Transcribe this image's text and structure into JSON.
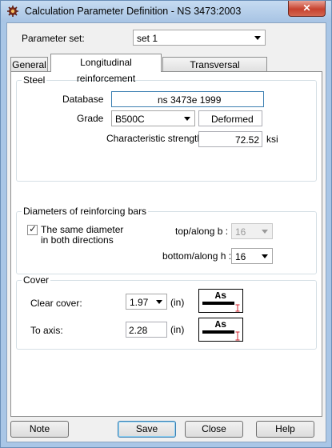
{
  "window": {
    "title": "Calculation Parameter Definition - NS 3473:2003",
    "close_symbol": "✕"
  },
  "parameter_set": {
    "label": "Parameter set:",
    "value": "set 1"
  },
  "tabs": [
    {
      "label": "General",
      "active": false
    },
    {
      "label": "Longitudinal reinforcement",
      "active": true
    },
    {
      "label": "Transversal reinforcement",
      "active": false
    }
  ],
  "steel": {
    "group_title": "Steel",
    "database_label": "Database",
    "database_value": "ns 3473e 1999",
    "grade_label": "Grade",
    "grade_value": "B500C",
    "deformed_value": "Deformed",
    "char_strength_label": "Characteristic strength",
    "char_strength_value": "72.52",
    "char_strength_unit": "ksi"
  },
  "diameters": {
    "group_title": "Diameters of reinforcing bars",
    "same_diameter_label_line1": "The same diameter",
    "same_diameter_label_line2": "in both directions",
    "same_diameter_checked": true,
    "top_label": "top/along b :",
    "top_value": "16",
    "bottom_label": "bottom/along h :",
    "bottom_value": "16"
  },
  "cover": {
    "group_title": "Cover",
    "clear_cover_label": "Clear cover:",
    "clear_cover_value": "1.97",
    "clear_cover_unit": "(in)",
    "to_axis_label": "To axis:",
    "to_axis_value": "2.28",
    "to_axis_unit": "(in)",
    "icon_text": "As"
  },
  "buttons": {
    "note": "Note",
    "save": "Save",
    "close": "Close",
    "help": "Help"
  },
  "colors": {
    "titlebar": "#a9c6e6",
    "close_button": "#c7422e",
    "dimension_marker": "#d0202a"
  }
}
